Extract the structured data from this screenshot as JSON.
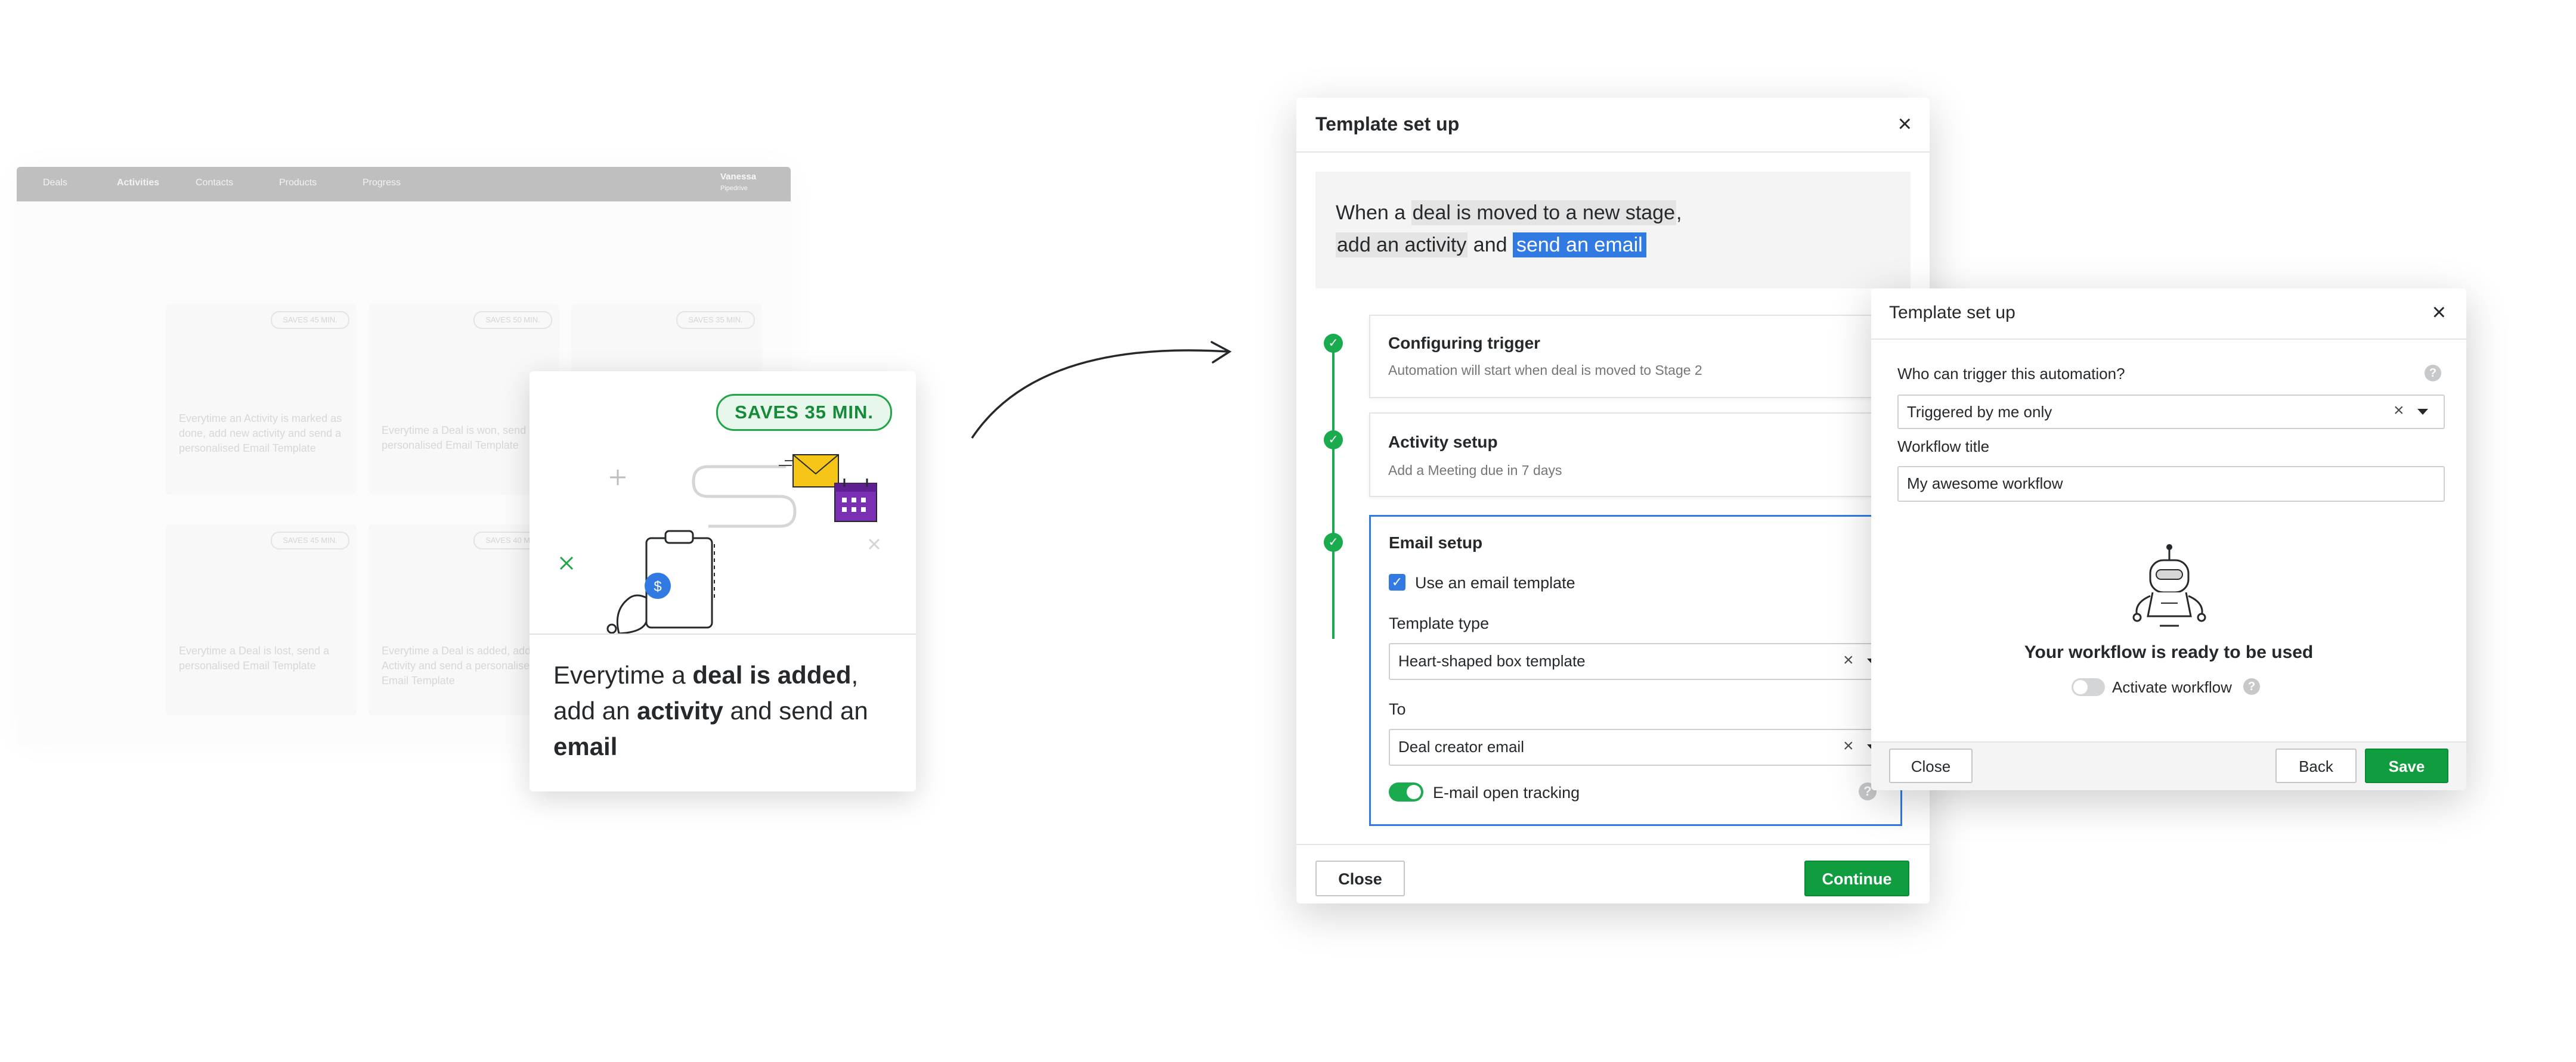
{
  "background_app": {
    "nav_items": [
      "Deals",
      "Activities",
      "Contacts",
      "Products",
      "Progress"
    ],
    "user_name": "Vanessa",
    "user_company": "Pipedrive",
    "card_badges": [
      "SAVES 45 MIN.",
      "SAVES 50 MIN.",
      "SAVES 35 MIN.",
      "SAVES 45 MIN.",
      "SAVES 40 MIN."
    ],
    "card_texts": [
      "Everytime an Activity is marked as done, add new activity and send a personalised Email Template",
      "Everytime a Deal is won, send a personalised Email Template",
      "Everytime a Deal is lost, send a personalised Email Template",
      "Everytime a Deal is added, add an Activity and send a personalised Email Template"
    ]
  },
  "automation_card": {
    "badge": "SAVES 35 MIN.",
    "text_1": "Everytime a ",
    "bold_1": "deal is added",
    "text_2": ", add an ",
    "bold_2": "activity",
    "text_3": " and send an ",
    "bold_3": "email",
    "icon_names": [
      "clipboard-dollar-icon",
      "envelope-icon",
      "calendar-icon"
    ],
    "colors": {
      "accent_green": "#21a547",
      "envelope": "#f5c518",
      "calendar": "#7b2fb5",
      "dollar": "#317ae2"
    }
  },
  "dialog_main": {
    "title": "Template set up",
    "sentence": {
      "part_1": "When a ",
      "hl_1": "deal is moved to a new stage",
      "part_2": ",",
      "hl_2": "add an activity",
      "part_3": " and ",
      "hl_3": "send an email"
    },
    "steps": [
      {
        "title": "Configuring trigger",
        "subtitle": "Automation will start when deal is moved to Stage 2"
      },
      {
        "title": "Activity setup",
        "subtitle": "Add a Meeting due in 7 days"
      },
      {
        "title": "Email setup"
      }
    ],
    "email": {
      "use_template_label": "Use an email template",
      "use_template_checked": true,
      "template_type_label": "Template type",
      "template_type_value": "Heart-shaped box template",
      "to_label": "To",
      "to_value": "Deal creator email",
      "tracking_label": "E-mail open tracking",
      "tracking_on": true
    },
    "close_label": "Close",
    "continue_label": "Continue"
  },
  "dialog_second": {
    "title": "Template set up",
    "who_label": "Who can trigger this automation?",
    "who_value": "Triggered by me only",
    "workflow_title_label": "Workflow title",
    "workflow_title_value": "My awesome workflow",
    "ready_text": "Your workflow is ready to be used",
    "activate_label": "Activate workflow",
    "activate_on": false,
    "close_label": "Close",
    "back_label": "Back",
    "save_label": "Save"
  },
  "colors": {
    "primary_green": "#0f9d3f",
    "step_green": "#1aab4f",
    "focus_blue": "#317ae2",
    "text_dark": "#26292c",
    "text_muted": "#747678"
  }
}
